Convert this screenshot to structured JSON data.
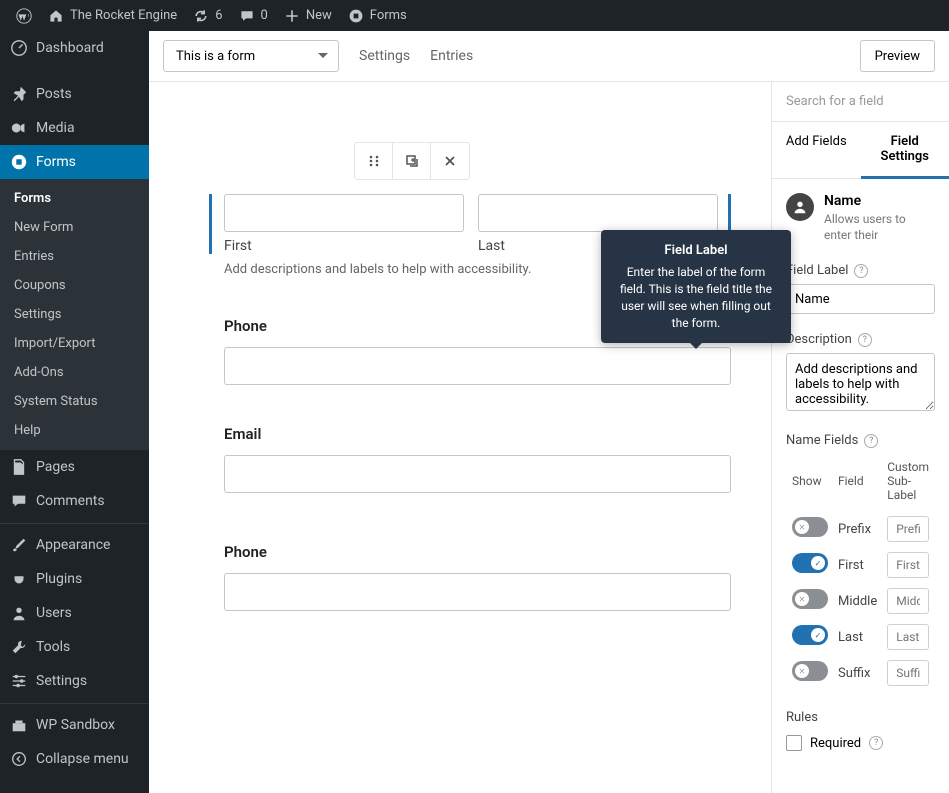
{
  "adminbar": {
    "site_name": "The Rocket Engine",
    "updates_count": "6",
    "comments_count": "0",
    "new_label": "New",
    "forms_label": "Forms"
  },
  "sidebar": {
    "items": [
      {
        "label": "Dashboard"
      },
      {
        "label": "Posts"
      },
      {
        "label": "Media"
      },
      {
        "label": "Forms"
      },
      {
        "label": "Pages"
      },
      {
        "label": "Comments"
      },
      {
        "label": "Appearance"
      },
      {
        "label": "Plugins"
      },
      {
        "label": "Users"
      },
      {
        "label": "Tools"
      },
      {
        "label": "Settings"
      },
      {
        "label": "WP Sandbox"
      },
      {
        "label": "Collapse menu"
      }
    ],
    "forms_submenu": [
      {
        "label": "Forms"
      },
      {
        "label": "New Form"
      },
      {
        "label": "Entries"
      },
      {
        "label": "Coupons"
      },
      {
        "label": "Settings"
      },
      {
        "label": "Import/Export"
      },
      {
        "label": "Add-Ons"
      },
      {
        "label": "System Status"
      },
      {
        "label": "Help"
      }
    ]
  },
  "topbar": {
    "form_name": "This is a form",
    "settings_label": "Settings",
    "entries_label": "Entries",
    "preview_label": "Preview"
  },
  "canvas": {
    "name_field": {
      "first_label": "First",
      "last_label": "Last"
    },
    "description_hint": "Add descriptions and labels to help with accessibility.",
    "fields": [
      {
        "label": "Phone"
      },
      {
        "label": "Email"
      },
      {
        "label": "Phone"
      }
    ]
  },
  "rightpanel": {
    "search_placeholder": "Search for a field",
    "tabs": {
      "add": "Add Fields",
      "settings": "Field Settings"
    },
    "field_type": {
      "name": "Name",
      "desc": "Allows users to enter their"
    },
    "field_label_label": "Field Label",
    "field_label_value": "Name",
    "description_label": "Description",
    "description_value": "Add descriptions and labels to help with accessibility.",
    "name_fields_label": "Name Fields",
    "table": {
      "headers": {
        "show": "Show",
        "field": "Field",
        "custom": "Custom Sub-Label"
      },
      "rows": [
        {
          "on": false,
          "field": "Prefix",
          "ph": "Prefix"
        },
        {
          "on": true,
          "field": "First",
          "ph": "First"
        },
        {
          "on": false,
          "field": "Middle",
          "ph": "Middle"
        },
        {
          "on": true,
          "field": "Last",
          "ph": "Last"
        },
        {
          "on": false,
          "field": "Suffix",
          "ph": "Suffix"
        }
      ]
    },
    "rules": {
      "title": "Rules",
      "required_label": "Required"
    }
  },
  "tooltip": {
    "title": "Field Label",
    "body": "Enter the label of the form field. This is the field title the user will see when filling out the form."
  }
}
